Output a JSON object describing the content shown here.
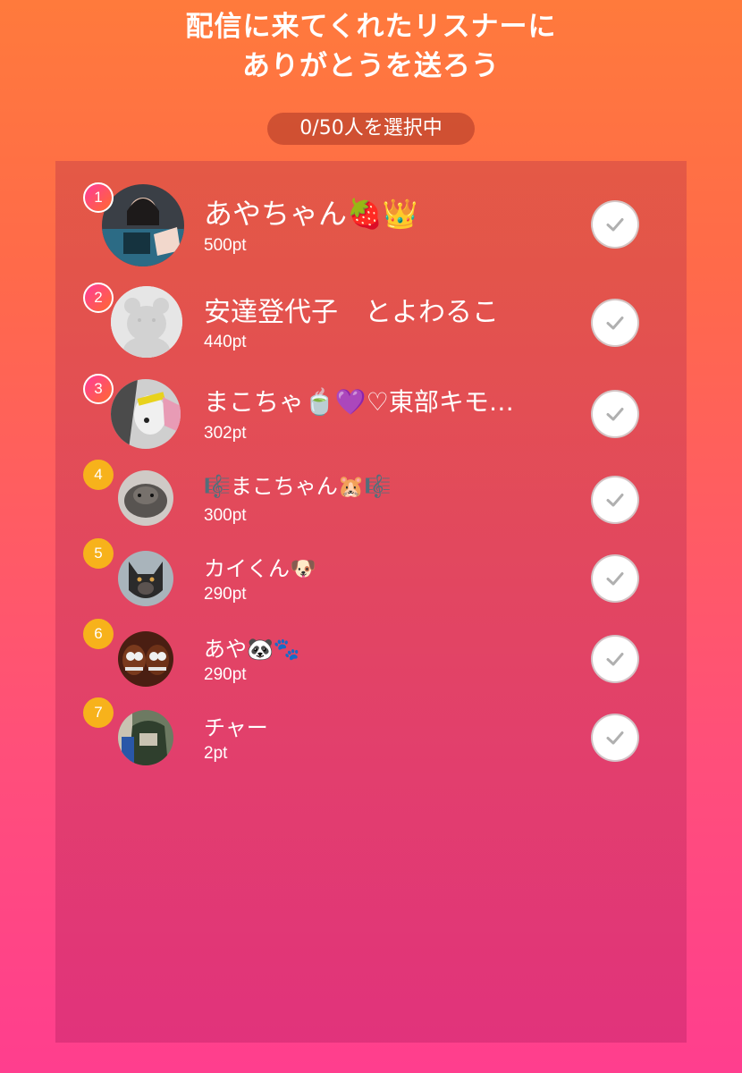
{
  "header": {
    "title_line1": "配信に来てくれたリスナーに",
    "title_line2": "ありがとうを送ろう",
    "counter": "0/50人を選択中"
  },
  "listeners": [
    {
      "rank": "1",
      "name": "あやちゃん🍓👑",
      "points": "500pt",
      "selected": false
    },
    {
      "rank": "2",
      "name": "安達登代子　とよわるこ",
      "points": "440pt",
      "selected": false
    },
    {
      "rank": "3",
      "name": "まこちゃ🍵💜♡東部キモ…",
      "points": "302pt",
      "selected": false
    },
    {
      "rank": "4",
      "name": "🎼まこちゃん🐹🎼",
      "points": "300pt",
      "selected": false
    },
    {
      "rank": "5",
      "name": "カイくん🐶",
      "points": "290pt",
      "selected": false
    },
    {
      "rank": "6",
      "name": "あや🐼🐾",
      "points": "290pt",
      "selected": false
    },
    {
      "rank": "7",
      "name": "チャー",
      "points": "2pt",
      "selected": false
    }
  ],
  "colors": {
    "top_rank_gradient_start": "#ff3b9b",
    "top_rank_gradient_end": "#ff6a2d",
    "rank_gold": "#f7b21b",
    "check_mark": "#b0b0b0"
  }
}
